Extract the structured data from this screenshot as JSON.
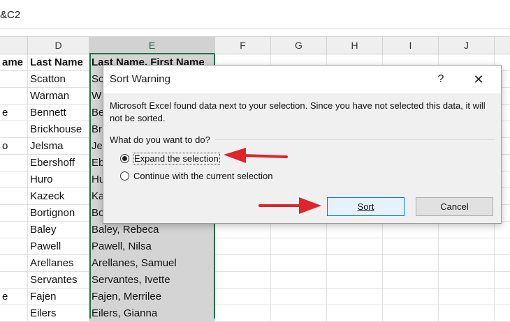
{
  "formula_bar": {
    "text": "&C2"
  },
  "columns": [
    {
      "letter": "D",
      "left": 0
    },
    {
      "letter": "E",
      "selected": true
    },
    {
      "letter": "F"
    },
    {
      "letter": "G"
    },
    {
      "letter": "H"
    },
    {
      "letter": "I"
    },
    {
      "letter": "J"
    }
  ],
  "headers": {
    "c": "ame",
    "d": "Last Name",
    "e": "Last Name, First Name"
  },
  "rows": [
    {
      "c": "",
      "d": "Scatton",
      "e": "Sc"
    },
    {
      "c": "",
      "d": "Warman",
      "e": "W"
    },
    {
      "c": "e",
      "d": "Bennett",
      "e": "Be"
    },
    {
      "c": "",
      "d": "Brickhouse",
      "e": "Br"
    },
    {
      "c": "o",
      "d": "Jelsma",
      "e": "Je"
    },
    {
      "c": "",
      "d": "Ebershoff",
      "e": "Eb"
    },
    {
      "c": "",
      "d": "Huro",
      "e": "Hu"
    },
    {
      "c": "",
      "d": "Kazeck",
      "e": "Ka"
    },
    {
      "c": "",
      "d": "Bortignon",
      "e": "Bo"
    },
    {
      "c": "",
      "d": "Baley",
      "e": "Baley, Rebeca"
    },
    {
      "c": "",
      "d": "Pawell",
      "e": "Pawell, Nilsa"
    },
    {
      "c": "",
      "d": "Arellanes",
      "e": "Arellanes, Samuel"
    },
    {
      "c": "",
      "d": "Servantes",
      "e": "Servantes, Ivette"
    },
    {
      "c": "e",
      "d": "Fajen",
      "e": "Fajen, Merrilee"
    },
    {
      "c": "",
      "d": "Eilers",
      "e": "Eilers, Gianna"
    }
  ],
  "dialog": {
    "title": "Sort Warning",
    "help": "?",
    "close": "✕",
    "message": "Microsoft Excel found data next to your selection.  Since you have not selected this data, it will not be sorted.",
    "question": "What do you want to do?",
    "options": [
      {
        "label": "Expand the selection",
        "checked": true
      },
      {
        "label": "Continue with the current selection",
        "checked": false
      }
    ],
    "sort_label": "Sort",
    "cancel_label": "Cancel"
  },
  "colors": {
    "selection_border": "#1f7145",
    "arrow": "#e0242b",
    "sort_border": "#0078d7"
  }
}
